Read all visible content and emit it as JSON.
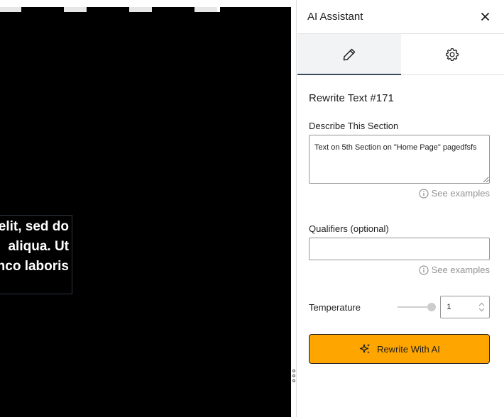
{
  "panel": {
    "title": "AI Assistant",
    "tabs": [
      {
        "icon": "pencil-icon",
        "active": true
      },
      {
        "icon": "gear-icon",
        "active": false
      }
    ]
  },
  "form": {
    "section_title": "Rewrite Text #171",
    "describe_label": "Describe This Section",
    "describe_value": "Text on 5th Section on \"Home Page\" pagedfsfs",
    "see_examples": "See examples",
    "qualifiers_label": "Qualifiers (optional)",
    "qualifiers_value": "",
    "temperature_label": "Temperature",
    "temperature_value": "1",
    "rewrite_button": "Rewrite With AI"
  },
  "canvas": {
    "text_lines": [
      "elit, sed do",
      "aliqua. Ut",
      "nco laboris"
    ]
  },
  "colors": {
    "accent": "#ffa500",
    "canvas_bg": "#000000"
  }
}
